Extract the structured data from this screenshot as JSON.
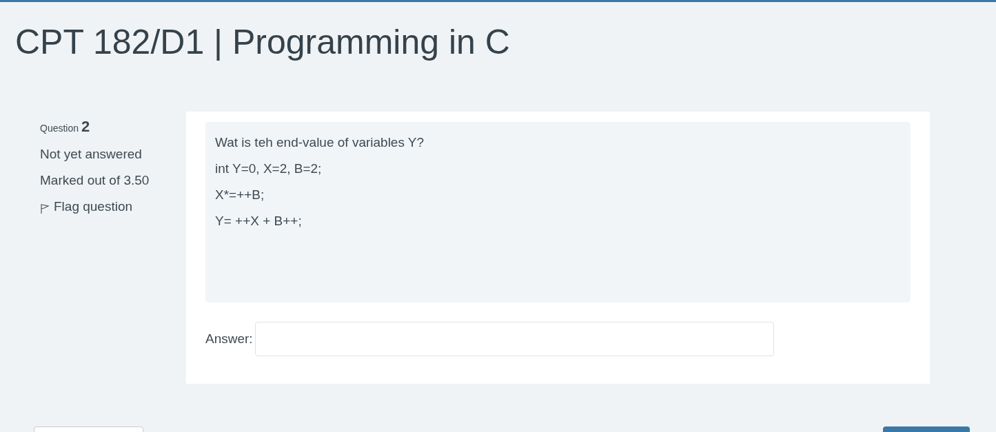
{
  "page_title": "CPT 182/D1 | Programming in C",
  "question_info": {
    "label": "Question",
    "number": "2",
    "state": "Not yet answered",
    "marks": "Marked out of 3.50",
    "flag": {
      "label": "Flag question",
      "flagged": false
    }
  },
  "question_text": [
    "Wat is teh end-value of variables  Y?",
    "int Y=0, X=2, B=2;",
    "X*=++B;",
    "Y= ++X + B++;"
  ],
  "answer": {
    "label": "Answer:"
  },
  "nav_buttons": [
    {
      "kind": "secondary"
    },
    {
      "kind": "primary"
    }
  ]
}
